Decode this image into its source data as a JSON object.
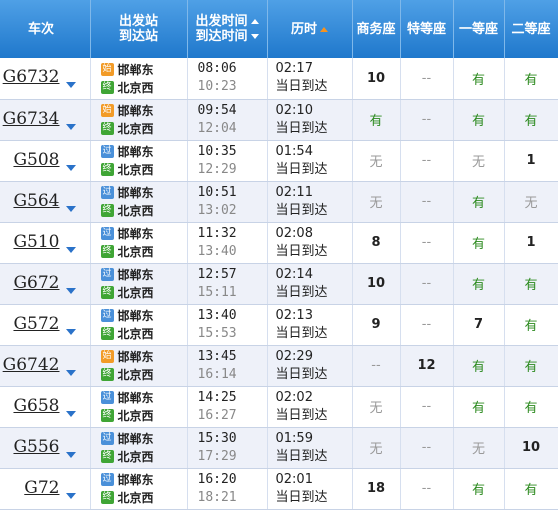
{
  "header": {
    "train": "车次",
    "from_station": "出发站",
    "to_station": "到达站",
    "dep_time": "出发时间",
    "arr_time": "到达时间",
    "duration": "历时",
    "business": "商务座",
    "premium": "特等座",
    "first": "一等座",
    "second": "二等座"
  },
  "rows": [
    {
      "train": "G6732",
      "from_type": "始",
      "from": "邯郸东",
      "to_type": "终",
      "to": "北京西",
      "dep": "08:06",
      "arr": "10:23",
      "dur": "02:17",
      "note": "当日到达",
      "biz": "10",
      "te": "--",
      "first": "有",
      "second": "有"
    },
    {
      "train": "G6734",
      "from_type": "始",
      "from": "邯郸东",
      "to_type": "终",
      "to": "北京西",
      "dep": "09:54",
      "arr": "12:04",
      "dur": "02:10",
      "note": "当日到达",
      "biz": "有",
      "te": "--",
      "first": "有",
      "second": "有"
    },
    {
      "train": "G508",
      "from_type": "过",
      "from": "邯郸东",
      "to_type": "终",
      "to": "北京西",
      "dep": "10:35",
      "arr": "12:29",
      "dur": "01:54",
      "note": "当日到达",
      "biz": "无",
      "te": "--",
      "first": "无",
      "second": "1"
    },
    {
      "train": "G564",
      "from_type": "过",
      "from": "邯郸东",
      "to_type": "终",
      "to": "北京西",
      "dep": "10:51",
      "arr": "13:02",
      "dur": "02:11",
      "note": "当日到达",
      "biz": "无",
      "te": "--",
      "first": "有",
      "second": "无"
    },
    {
      "train": "G510",
      "from_type": "过",
      "from": "邯郸东",
      "to_type": "终",
      "to": "北京西",
      "dep": "11:32",
      "arr": "13:40",
      "dur": "02:08",
      "note": "当日到达",
      "biz": "8",
      "te": "--",
      "first": "有",
      "second": "1"
    },
    {
      "train": "G672",
      "from_type": "过",
      "from": "邯郸东",
      "to_type": "终",
      "to": "北京西",
      "dep": "12:57",
      "arr": "15:11",
      "dur": "02:14",
      "note": "当日到达",
      "biz": "10",
      "te": "--",
      "first": "有",
      "second": "有"
    },
    {
      "train": "G572",
      "from_type": "过",
      "from": "邯郸东",
      "to_type": "终",
      "to": "北京西",
      "dep": "13:40",
      "arr": "15:53",
      "dur": "02:13",
      "note": "当日到达",
      "biz": "9",
      "te": "--",
      "first": "7",
      "second": "有"
    },
    {
      "train": "G6742",
      "from_type": "始",
      "from": "邯郸东",
      "to_type": "终",
      "to": "北京西",
      "dep": "13:45",
      "arr": "16:14",
      "dur": "02:29",
      "note": "当日到达",
      "biz": "--",
      "te": "12",
      "first": "有",
      "second": "有"
    },
    {
      "train": "G658",
      "from_type": "过",
      "from": "邯郸东",
      "to_type": "终",
      "to": "北京西",
      "dep": "14:25",
      "arr": "16:27",
      "dur": "02:02",
      "note": "当日到达",
      "biz": "无",
      "te": "--",
      "first": "有",
      "second": "有"
    },
    {
      "train": "G556",
      "from_type": "过",
      "from": "邯郸东",
      "to_type": "终",
      "to": "北京西",
      "dep": "15:30",
      "arr": "17:29",
      "dur": "01:59",
      "note": "当日到达",
      "biz": "无",
      "te": "--",
      "first": "无",
      "second": "10"
    },
    {
      "train": "G72",
      "from_type": "过",
      "from": "邯郸东",
      "to_type": "终",
      "to": "北京西",
      "dep": "16:20",
      "arr": "18:21",
      "dur": "02:01",
      "note": "当日到达",
      "biz": "18",
      "te": "--",
      "first": "有",
      "second": "有"
    }
  ],
  "colors": {
    "header_top": "#4fa0e6",
    "header_bottom": "#1f78cc",
    "badge_start": "#f29b27",
    "badge_pass": "#4a90d9",
    "badge_end": "#3fa535",
    "available": "#2b8a1e",
    "sort_active": "#f7931e"
  }
}
